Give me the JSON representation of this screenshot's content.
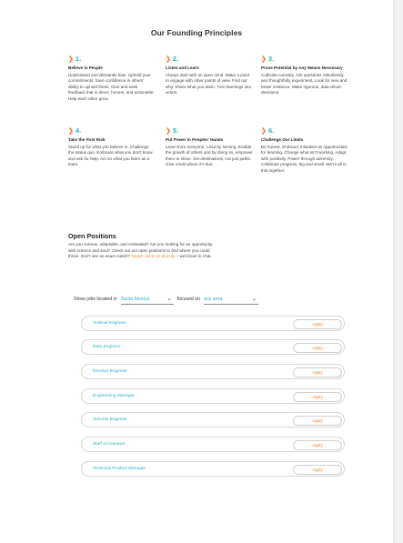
{
  "page": {
    "title": "Our Founding Principles"
  },
  "principles": [
    {
      "number": "1.",
      "title": "Believe in People",
      "body": "Understand and dismantle bias. Uphold your commitments; have confidence in others' ability to uphold theirs. Give and seek feedback that is direct, honest, and actionable. Help each other grow."
    },
    {
      "number": "2.",
      "title": "Listen and Learn",
      "body": "Always start with an open mind. Make a point to engage with other points of view. Find out why. Share what you learn. Turn learnings into action."
    },
    {
      "number": "3.",
      "title": "Prove Potential by Any Means Necessary",
      "body": "Cultivate curiosity. Ask questions relentlessly and thoughtfully experiment. Look for new and better evidence. Make rigorous, data-driven decisions."
    },
    {
      "number": "4.",
      "title": "Take the First Risk",
      "body": "Stand up for what you believe in. Challenge the status quo. Embrace what you don't know and ask for help. Act on what you learn as a team."
    },
    {
      "number": "5.",
      "title": "Put Power in Peoples' Hands",
      "body": "Learn from everyone. Lead by serving. Enable the growth of others and by doing so, empower them to shine. Set destinations, not just paths. Give credit where it's due."
    },
    {
      "number": "6.",
      "title": "Challenge Our Limits",
      "body": "Be honest. Embrace mistakes as opportunities for learning. Change what isn't working. Adapt with positivity. Power through adversity. Celebrate progress, big and small. We're all in this together."
    }
  ],
  "positions": {
    "title": "Open Positions",
    "intro": "Are you curious, adaptable, and motivated? Are you looking for an opportunity with science and soul? Check out our open positions to find where you could thrive. Don't see an exact match?",
    "intro_link": "Reach out to us directly",
    "intro_tail": " – we'd love to chat.",
    "filter": {
      "prefix": "Show jobs located in",
      "location": "Santa Monica",
      "middle": "focused on",
      "area": "any area"
    },
    "apply_label": "Apply",
    "jobs": [
      "Android Engineer",
      "Data Engineer",
      "DevOps Engineer",
      "Engineering Manager",
      "Security Engineer",
      "Staff Accountant",
      "Technical Product Manager"
    ]
  },
  "colors": {
    "accent_teal": "#2ab3c4",
    "accent_orange": "#f47f2a"
  },
  "icons": {
    "principle_marker": "chevron-right-icon",
    "dropdown": "chevron-down-icon"
  }
}
